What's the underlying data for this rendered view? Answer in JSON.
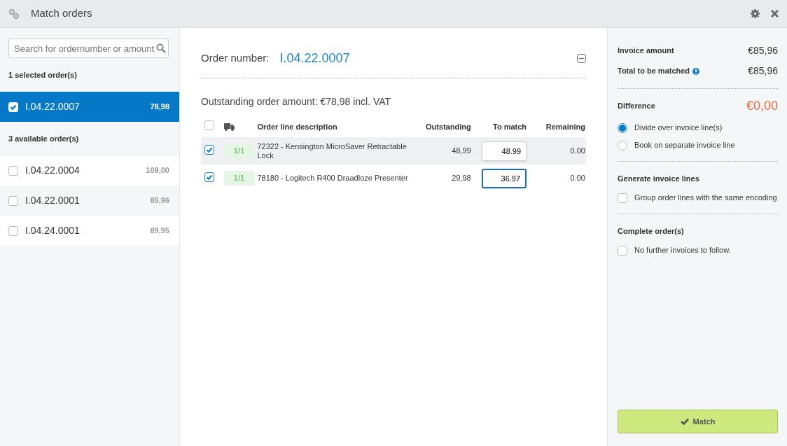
{
  "window": {
    "title": "Match orders"
  },
  "search": {
    "placeholder": "Search for ordernumber or amount"
  },
  "selected_header": "1 selected order(s)",
  "selected_orders": [
    {
      "number": "I.04.22.0007",
      "amount": "78,98",
      "checked": true,
      "selected": true
    }
  ],
  "available_header": "3 available order(s)",
  "available_orders": [
    {
      "number": "I.04.22.0004",
      "amount": "109,00",
      "checked": false,
      "selected": false
    },
    {
      "number": "I.04.22.0001",
      "amount": "85,96",
      "checked": false,
      "selected": false
    },
    {
      "number": "I.04.24.0001",
      "amount": "89,95",
      "checked": false,
      "selected": false
    }
  ],
  "order": {
    "label": "Order number:",
    "number": "I.04.22.0007",
    "outstanding": "Outstanding order amount: €78,98 incl. VAT"
  },
  "table": {
    "select_all": false,
    "columns": [
      "Order line description",
      "Outstanding",
      "To match",
      "Remaining"
    ],
    "rows": [
      {
        "checked": true,
        "highlighted": true,
        "delivery": "1/1",
        "description": "72322 - Kensington MicroSaver Retractable Lock",
        "outstanding": "48,99",
        "to_match": "48.99",
        "focused": false,
        "remaining": "0.00"
      },
      {
        "checked": true,
        "highlighted": false,
        "delivery": "1/1",
        "description": "78180 - Logitech R400 Draadloze Presenter",
        "outstanding": "29,98",
        "to_match": "36.97",
        "focused": true,
        "remaining": "0.00"
      }
    ]
  },
  "summary": {
    "invoice_amount_label": "Invoice amount",
    "invoice_amount": "€85,96",
    "total_label": "Total to be matched",
    "total": "€85,96",
    "difference_label": "Difference",
    "difference": "€0,00",
    "difference_options": [
      {
        "label": "Divide over invoice line(s)",
        "selected": true
      },
      {
        "label": "Book on separate invoice line",
        "selected": false
      }
    ],
    "generate_header": "Generate invoice lines",
    "group_option": {
      "label": "Group order lines with the same encoding",
      "checked": false
    },
    "complete_header": "Complete order(s)",
    "complete_option": {
      "label": "No further invoices to follow.",
      "checked": false
    }
  },
  "match_button": "Match"
}
